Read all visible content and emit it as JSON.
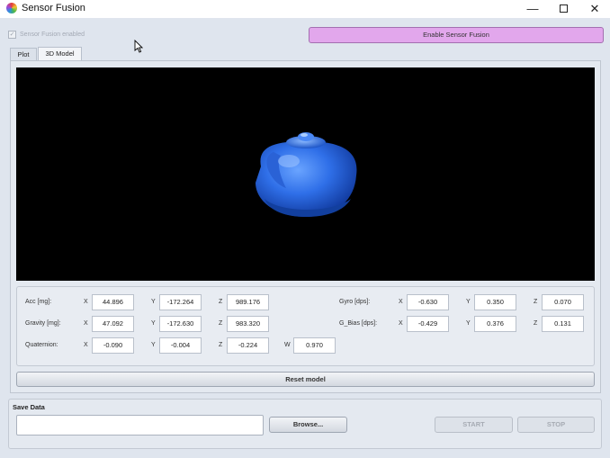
{
  "window": {
    "title": "Sensor Fusion",
    "minimize_glyph": "—",
    "close_glyph": "✕"
  },
  "sensor_fusion_checkbox": {
    "label": "Sensor Fusion enabled",
    "checked": true,
    "enabled": false,
    "check_glyph": "✓"
  },
  "enable_button": {
    "label": "Enable Sensor Fusion",
    "color": "#e2a7ec"
  },
  "tabs": [
    {
      "label": "Plot",
      "active": false
    },
    {
      "label": "3D Model",
      "active": true
    }
  ],
  "model": {
    "name": "teapot",
    "color": "#2f6fe8"
  },
  "readings": {
    "acc": {
      "label": "Acc [mg]:",
      "x": "44.896",
      "y": "-172.264",
      "z": "989.176"
    },
    "gravity": {
      "label": "Gravity [mg]:",
      "x": "47.092",
      "y": "-172.630",
      "z": "983.320"
    },
    "quaternion": {
      "label": "Quaternion:",
      "x": "-0.090",
      "y": "-0.004",
      "z": "-0.224",
      "w": "0.970"
    },
    "gyro": {
      "label": "Gyro [dps]:",
      "x": "-0.630",
      "y": "0.350",
      "z": "0.070"
    },
    "g_bias": {
      "label": "G_Bias [dps]:",
      "x": "-0.429",
      "y": "0.376",
      "z": "0.131"
    }
  },
  "axis_labels": {
    "x": "X",
    "y": "Y",
    "z": "Z",
    "w": "W"
  },
  "reset_button": {
    "label": "Reset model"
  },
  "save_data": {
    "title": "Save Data",
    "path_value": "",
    "browse_label": "Browse...",
    "start_label": "START",
    "stop_label": "STOP"
  }
}
